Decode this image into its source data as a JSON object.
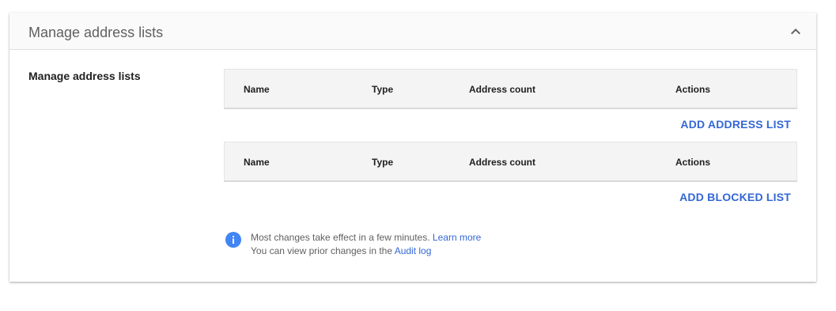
{
  "panel": {
    "title": "Manage address lists",
    "collapse_icon": "chevron-up-icon"
  },
  "section": {
    "label": "Manage address lists"
  },
  "address_table": {
    "columns": [
      "Name",
      "Type",
      "Address count",
      "Actions"
    ],
    "add_button": "ADD ADDRESS LIST"
  },
  "blocked_table": {
    "columns": [
      "Name",
      "Type",
      "Address count",
      "Actions"
    ],
    "add_button": "ADD BLOCKED LIST"
  },
  "info": {
    "icon": "info-icon",
    "line1_text": "Most changes take effect in a few minutes.",
    "line1_link": "Learn more",
    "line2_text": "You can view prior changes in the",
    "line2_link": "Audit log"
  },
  "colors": {
    "accent": "#3367d6",
    "info_icon": "#4285f4",
    "header_bg": "#fafafa",
    "table_header_bg": "#f4f4f4"
  }
}
